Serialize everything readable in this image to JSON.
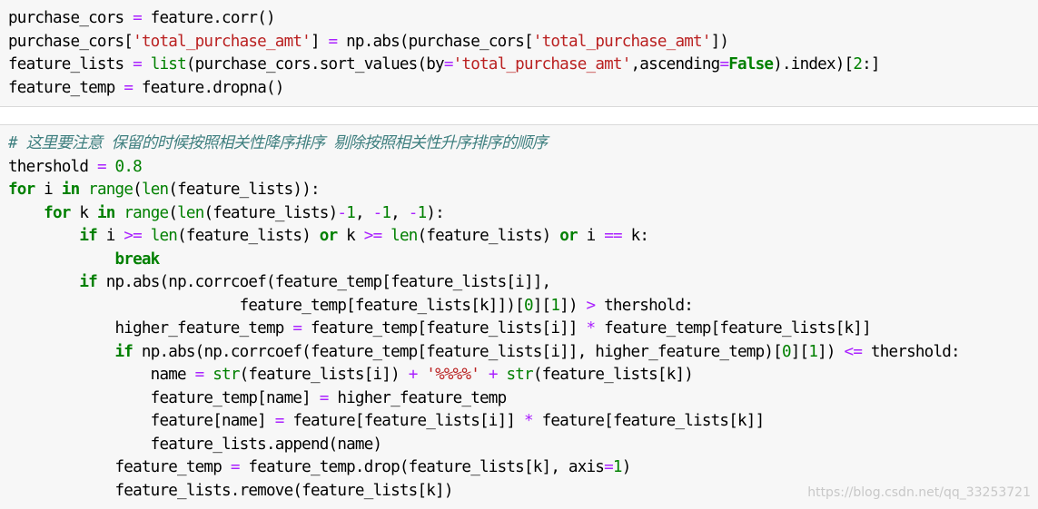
{
  "cells": [
    {
      "lines": [
        [
          [
            "t",
            "purchase_cors "
          ],
          [
            "o",
            "="
          ],
          [
            "t",
            " feature.corr()"
          ]
        ],
        [
          [
            "t",
            "purchase_cors["
          ],
          [
            "s",
            "'total_purchase_amt'"
          ],
          [
            "t",
            "] "
          ],
          [
            "o",
            "="
          ],
          [
            "t",
            " np.abs(purchase_cors["
          ],
          [
            "s",
            "'total_purchase_amt'"
          ],
          [
            "t",
            "])"
          ]
        ],
        [
          [
            "t",
            "feature_lists "
          ],
          [
            "o",
            "="
          ],
          [
            "t",
            " "
          ],
          [
            "b",
            "list"
          ],
          [
            "t",
            "(purchase_cors.sort_values(by"
          ],
          [
            "o",
            "="
          ],
          [
            "s",
            "'total_purchase_amt'"
          ],
          [
            "t",
            ",ascending"
          ],
          [
            "o",
            "="
          ],
          [
            "k",
            "False"
          ],
          [
            "t",
            ").index)["
          ],
          [
            "n",
            "2"
          ],
          [
            "t",
            ":]"
          ]
        ],
        [
          [
            "t",
            "feature_temp "
          ],
          [
            "o",
            "="
          ],
          [
            "t",
            " feature.dropna()"
          ]
        ]
      ]
    },
    {
      "lines": [
        [
          [
            "c",
            "# 这里要注意 保留的时候按照相关性降序排序 剔除按照相关性升序排序的顺序"
          ]
        ],
        [
          [
            "t",
            "thershold "
          ],
          [
            "o",
            "="
          ],
          [
            "t",
            " "
          ],
          [
            "n",
            "0.8"
          ]
        ],
        [
          [
            "k",
            "for"
          ],
          [
            "t",
            " i "
          ],
          [
            "k",
            "in"
          ],
          [
            "t",
            " "
          ],
          [
            "b",
            "range"
          ],
          [
            "t",
            "("
          ],
          [
            "b",
            "len"
          ],
          [
            "t",
            "(feature_lists)):"
          ]
        ],
        [
          [
            "t",
            "    "
          ],
          [
            "k",
            "for"
          ],
          [
            "t",
            " k "
          ],
          [
            "k",
            "in"
          ],
          [
            "t",
            " "
          ],
          [
            "b",
            "range"
          ],
          [
            "t",
            "("
          ],
          [
            "b",
            "len"
          ],
          [
            "t",
            "(feature_lists)"
          ],
          [
            "o",
            "-"
          ],
          [
            "n",
            "1"
          ],
          [
            "t",
            ", "
          ],
          [
            "o",
            "-"
          ],
          [
            "n",
            "1"
          ],
          [
            "t",
            ", "
          ],
          [
            "o",
            "-"
          ],
          [
            "n",
            "1"
          ],
          [
            "t",
            "):"
          ]
        ],
        [
          [
            "t",
            "        "
          ],
          [
            "k",
            "if"
          ],
          [
            "t",
            " i "
          ],
          [
            "o",
            ">="
          ],
          [
            "t",
            " "
          ],
          [
            "b",
            "len"
          ],
          [
            "t",
            "(feature_lists) "
          ],
          [
            "k",
            "or"
          ],
          [
            "t",
            " k "
          ],
          [
            "o",
            ">="
          ],
          [
            "t",
            " "
          ],
          [
            "b",
            "len"
          ],
          [
            "t",
            "(feature_lists) "
          ],
          [
            "k",
            "or"
          ],
          [
            "t",
            " i "
          ],
          [
            "o",
            "=="
          ],
          [
            "t",
            " k:"
          ]
        ],
        [
          [
            "t",
            "            "
          ],
          [
            "k",
            "break"
          ]
        ],
        [
          [
            "t",
            "        "
          ],
          [
            "k",
            "if"
          ],
          [
            "t",
            " np.abs(np.corrcoef(feature_temp[feature_lists[i]],"
          ]
        ],
        [
          [
            "t",
            "                          feature_temp[feature_lists[k]])["
          ],
          [
            "n",
            "0"
          ],
          [
            "t",
            "]["
          ],
          [
            "n",
            "1"
          ],
          [
            "t",
            "]) "
          ],
          [
            "o",
            ">"
          ],
          [
            "t",
            " thershold:"
          ]
        ],
        [
          [
            "t",
            "            higher_feature_temp "
          ],
          [
            "o",
            "="
          ],
          [
            "t",
            " feature_temp[feature_lists[i]] "
          ],
          [
            "o",
            "*"
          ],
          [
            "t",
            " feature_temp[feature_lists[k]]"
          ]
        ],
        [
          [
            "t",
            "            "
          ],
          [
            "k",
            "if"
          ],
          [
            "t",
            " np.abs(np.corrcoef(feature_temp[feature_lists[i]], higher_feature_temp)["
          ],
          [
            "n",
            "0"
          ],
          [
            "t",
            "]["
          ],
          [
            "n",
            "1"
          ],
          [
            "t",
            "]) "
          ],
          [
            "o",
            "<="
          ],
          [
            "t",
            " thershold:"
          ]
        ],
        [
          [
            "t",
            "                name "
          ],
          [
            "o",
            "="
          ],
          [
            "t",
            " "
          ],
          [
            "b",
            "str"
          ],
          [
            "t",
            "(feature_lists[i]) "
          ],
          [
            "o",
            "+"
          ],
          [
            "t",
            " "
          ],
          [
            "s",
            "'%%%%'"
          ],
          [
            "t",
            " "
          ],
          [
            "o",
            "+"
          ],
          [
            "t",
            " "
          ],
          [
            "b",
            "str"
          ],
          [
            "t",
            "(feature_lists[k])"
          ]
        ],
        [
          [
            "t",
            "                feature_temp[name] "
          ],
          [
            "o",
            "="
          ],
          [
            "t",
            " higher_feature_temp"
          ]
        ],
        [
          [
            "t",
            "                feature[name] "
          ],
          [
            "o",
            "="
          ],
          [
            "t",
            " feature[feature_lists[i]] "
          ],
          [
            "o",
            "*"
          ],
          [
            "t",
            " feature[feature_lists[k]]"
          ]
        ],
        [
          [
            "t",
            "                feature_lists.append(name)"
          ]
        ],
        [
          [
            "t",
            "            feature_temp "
          ],
          [
            "o",
            "="
          ],
          [
            "t",
            " feature_temp.drop(feature_lists[k], axis"
          ],
          [
            "o",
            "="
          ],
          [
            "n",
            "1"
          ],
          [
            "t",
            ")"
          ]
        ],
        [
          [
            "t",
            "            feature_lists.remove(feature_lists[k])"
          ]
        ]
      ]
    }
  ],
  "watermark": "https://blog.csdn.net/qq_33253721",
  "colors": {
    "keyword": "#008000",
    "builtin": "#008000",
    "operator": "#aa22ff",
    "number": "#008000",
    "string": "#ba2121",
    "comment": "#408080",
    "cell_background": "#f7f7f7"
  }
}
